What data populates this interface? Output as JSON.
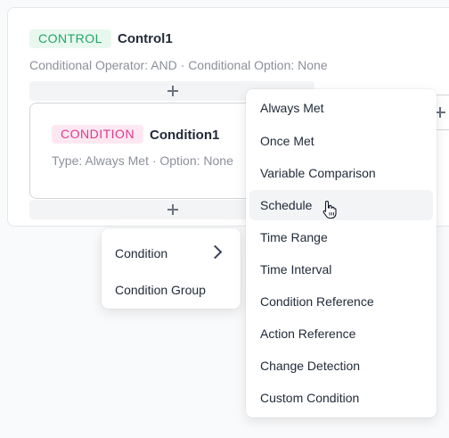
{
  "control": {
    "badge": "CONTROL",
    "title": "Control1",
    "meta": "Conditional Operator: AND · Conditional Option: None"
  },
  "condition": {
    "badge": "CONDITION",
    "title": "Condition1",
    "meta": "Type: Always Met · Option: None"
  },
  "add_menu": {
    "items": [
      "Condition",
      "Condition Group"
    ]
  },
  "condition_type_menu": {
    "items": [
      "Always Met",
      "Once Met",
      "Variable Comparison",
      "Schedule",
      "Time Range",
      "Time Interval",
      "Condition Reference",
      "Action Reference",
      "Change Detection",
      "Custom Condition"
    ],
    "highlighted": "Schedule"
  },
  "icons": [
    "plus-icon",
    "chevron-right-icon",
    "hand-pointer-icon"
  ],
  "colors": {
    "control_badge_bg": "#e8f8ef",
    "control_badge_text": "#22a566",
    "condition_badge_bg": "#fde8f2",
    "condition_badge_text": "#db3a8b"
  }
}
